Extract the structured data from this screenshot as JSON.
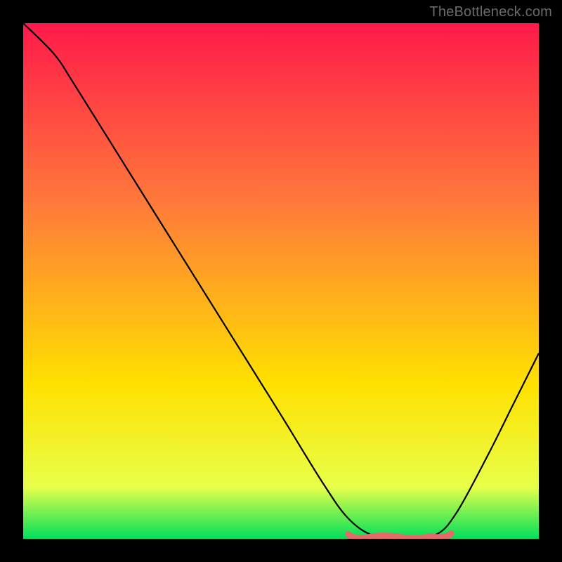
{
  "watermark": "TheBottleneck.com",
  "chart_data": {
    "type": "line",
    "title": "",
    "xlabel": "",
    "ylabel": "",
    "xlim": [
      0,
      100
    ],
    "ylim": [
      0,
      100
    ],
    "grid": false,
    "gradient": {
      "top_color": "#ff1a4a",
      "mid_color": "#ffe100",
      "bottom_color": "#00e05a"
    },
    "curve": {
      "color": "#000000",
      "points": [
        {
          "x": 0,
          "y": 100
        },
        {
          "x": 6,
          "y": 94
        },
        {
          "x": 10,
          "y": 88
        },
        {
          "x": 20,
          "y": 72
        },
        {
          "x": 30,
          "y": 56
        },
        {
          "x": 40,
          "y": 40
        },
        {
          "x": 50,
          "y": 24
        },
        {
          "x": 58,
          "y": 11
        },
        {
          "x": 63,
          "y": 4
        },
        {
          "x": 68,
          "y": 0.6
        },
        {
          "x": 74,
          "y": 0.3
        },
        {
          "x": 80,
          "y": 0.8
        },
        {
          "x": 84,
          "y": 5
        },
        {
          "x": 90,
          "y": 16
        },
        {
          "x": 95,
          "y": 26
        },
        {
          "x": 100,
          "y": 36
        }
      ]
    },
    "highlight": {
      "color": "#e46a6a",
      "range_x": [
        63,
        83
      ],
      "y": 0.6
    }
  }
}
